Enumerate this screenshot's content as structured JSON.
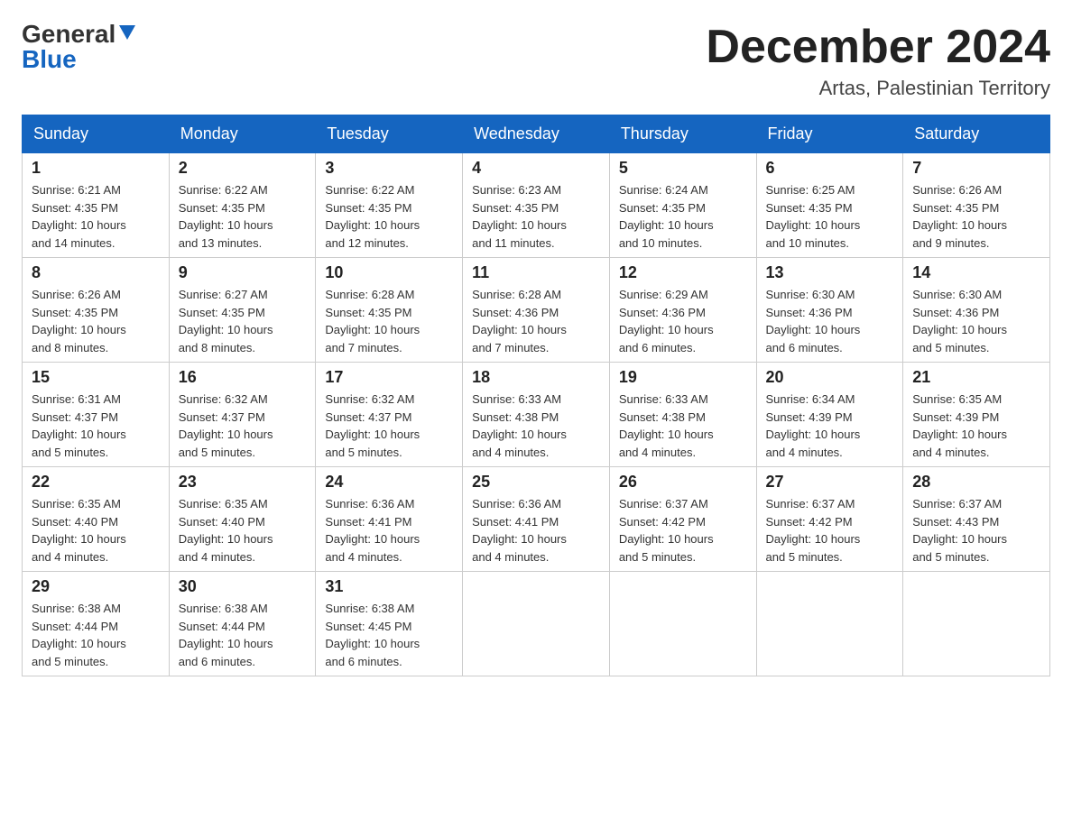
{
  "header": {
    "logo_general": "General",
    "logo_blue": "Blue",
    "month_title": "December 2024",
    "location": "Artas, Palestinian Territory"
  },
  "weekdays": [
    "Sunday",
    "Monday",
    "Tuesday",
    "Wednesday",
    "Thursday",
    "Friday",
    "Saturday"
  ],
  "weeks": [
    [
      {
        "day": "1",
        "info": "Sunrise: 6:21 AM\nSunset: 4:35 PM\nDaylight: 10 hours\nand 14 minutes."
      },
      {
        "day": "2",
        "info": "Sunrise: 6:22 AM\nSunset: 4:35 PM\nDaylight: 10 hours\nand 13 minutes."
      },
      {
        "day": "3",
        "info": "Sunrise: 6:22 AM\nSunset: 4:35 PM\nDaylight: 10 hours\nand 12 minutes."
      },
      {
        "day": "4",
        "info": "Sunrise: 6:23 AM\nSunset: 4:35 PM\nDaylight: 10 hours\nand 11 minutes."
      },
      {
        "day": "5",
        "info": "Sunrise: 6:24 AM\nSunset: 4:35 PM\nDaylight: 10 hours\nand 10 minutes."
      },
      {
        "day": "6",
        "info": "Sunrise: 6:25 AM\nSunset: 4:35 PM\nDaylight: 10 hours\nand 10 minutes."
      },
      {
        "day": "7",
        "info": "Sunrise: 6:26 AM\nSunset: 4:35 PM\nDaylight: 10 hours\nand 9 minutes."
      }
    ],
    [
      {
        "day": "8",
        "info": "Sunrise: 6:26 AM\nSunset: 4:35 PM\nDaylight: 10 hours\nand 8 minutes."
      },
      {
        "day": "9",
        "info": "Sunrise: 6:27 AM\nSunset: 4:35 PM\nDaylight: 10 hours\nand 8 minutes."
      },
      {
        "day": "10",
        "info": "Sunrise: 6:28 AM\nSunset: 4:35 PM\nDaylight: 10 hours\nand 7 minutes."
      },
      {
        "day": "11",
        "info": "Sunrise: 6:28 AM\nSunset: 4:36 PM\nDaylight: 10 hours\nand 7 minutes."
      },
      {
        "day": "12",
        "info": "Sunrise: 6:29 AM\nSunset: 4:36 PM\nDaylight: 10 hours\nand 6 minutes."
      },
      {
        "day": "13",
        "info": "Sunrise: 6:30 AM\nSunset: 4:36 PM\nDaylight: 10 hours\nand 6 minutes."
      },
      {
        "day": "14",
        "info": "Sunrise: 6:30 AM\nSunset: 4:36 PM\nDaylight: 10 hours\nand 5 minutes."
      }
    ],
    [
      {
        "day": "15",
        "info": "Sunrise: 6:31 AM\nSunset: 4:37 PM\nDaylight: 10 hours\nand 5 minutes."
      },
      {
        "day": "16",
        "info": "Sunrise: 6:32 AM\nSunset: 4:37 PM\nDaylight: 10 hours\nand 5 minutes."
      },
      {
        "day": "17",
        "info": "Sunrise: 6:32 AM\nSunset: 4:37 PM\nDaylight: 10 hours\nand 5 minutes."
      },
      {
        "day": "18",
        "info": "Sunrise: 6:33 AM\nSunset: 4:38 PM\nDaylight: 10 hours\nand 4 minutes."
      },
      {
        "day": "19",
        "info": "Sunrise: 6:33 AM\nSunset: 4:38 PM\nDaylight: 10 hours\nand 4 minutes."
      },
      {
        "day": "20",
        "info": "Sunrise: 6:34 AM\nSunset: 4:39 PM\nDaylight: 10 hours\nand 4 minutes."
      },
      {
        "day": "21",
        "info": "Sunrise: 6:35 AM\nSunset: 4:39 PM\nDaylight: 10 hours\nand 4 minutes."
      }
    ],
    [
      {
        "day": "22",
        "info": "Sunrise: 6:35 AM\nSunset: 4:40 PM\nDaylight: 10 hours\nand 4 minutes."
      },
      {
        "day": "23",
        "info": "Sunrise: 6:35 AM\nSunset: 4:40 PM\nDaylight: 10 hours\nand 4 minutes."
      },
      {
        "day": "24",
        "info": "Sunrise: 6:36 AM\nSunset: 4:41 PM\nDaylight: 10 hours\nand 4 minutes."
      },
      {
        "day": "25",
        "info": "Sunrise: 6:36 AM\nSunset: 4:41 PM\nDaylight: 10 hours\nand 4 minutes."
      },
      {
        "day": "26",
        "info": "Sunrise: 6:37 AM\nSunset: 4:42 PM\nDaylight: 10 hours\nand 5 minutes."
      },
      {
        "day": "27",
        "info": "Sunrise: 6:37 AM\nSunset: 4:42 PM\nDaylight: 10 hours\nand 5 minutes."
      },
      {
        "day": "28",
        "info": "Sunrise: 6:37 AM\nSunset: 4:43 PM\nDaylight: 10 hours\nand 5 minutes."
      }
    ],
    [
      {
        "day": "29",
        "info": "Sunrise: 6:38 AM\nSunset: 4:44 PM\nDaylight: 10 hours\nand 5 minutes."
      },
      {
        "day": "30",
        "info": "Sunrise: 6:38 AM\nSunset: 4:44 PM\nDaylight: 10 hours\nand 6 minutes."
      },
      {
        "day": "31",
        "info": "Sunrise: 6:38 AM\nSunset: 4:45 PM\nDaylight: 10 hours\nand 6 minutes."
      },
      null,
      null,
      null,
      null
    ]
  ]
}
